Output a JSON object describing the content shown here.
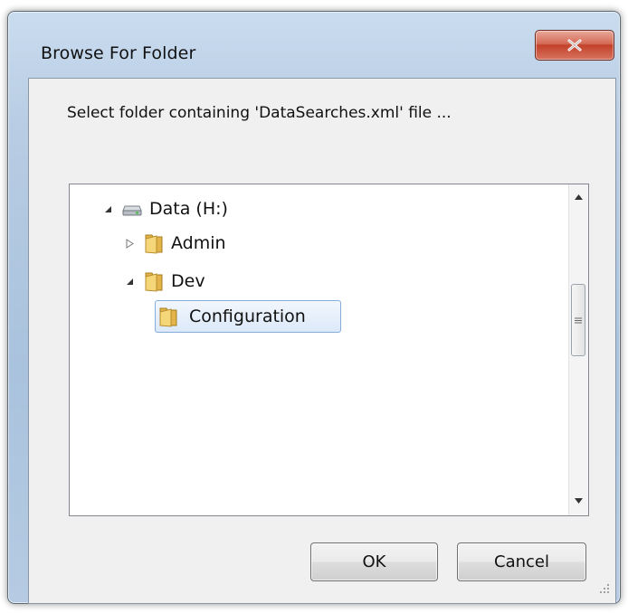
{
  "window": {
    "title": "Browse For Folder",
    "close_label": "X"
  },
  "dialog": {
    "prompt": "Select folder containing 'DataSearches.xml' file ..."
  },
  "tree": {
    "items": [
      {
        "label": "Data (H:)",
        "icon": "drive-icon",
        "state": "expanded"
      },
      {
        "label": "Admin",
        "icon": "folder-icon",
        "state": "collapsed"
      },
      {
        "label": "Dev",
        "icon": "folder-icon",
        "state": "expanded"
      },
      {
        "label": "Configuration",
        "icon": "folder-icon",
        "state": "selected"
      }
    ]
  },
  "buttons": {
    "ok": "OK",
    "cancel": "Cancel"
  },
  "colors": {
    "selection": "#dbe9f9",
    "close": "#c2412a"
  }
}
